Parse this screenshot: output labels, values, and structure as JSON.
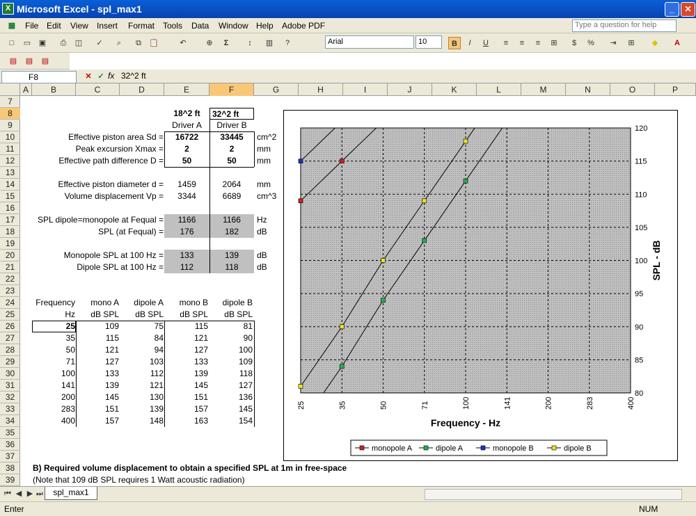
{
  "window": {
    "title": "Microsoft Excel - spl_max1"
  },
  "menu": [
    "File",
    "Edit",
    "View",
    "Insert",
    "Format",
    "Tools",
    "Data",
    "Window",
    "Help",
    "Adobe PDF"
  ],
  "ask_placeholder": "Type a question for help",
  "toolbar": {
    "font": "Arial",
    "size": "10"
  },
  "formula_bar": {
    "cell_ref": "F8",
    "formula": "32^2 ft"
  },
  "columns": [
    "A",
    "B",
    "C",
    "D",
    "E",
    "F",
    "G",
    "H",
    "I",
    "J",
    "K",
    "L",
    "M",
    "N",
    "O",
    "P"
  ],
  "rows": [
    "7",
    "8",
    "9",
    "10",
    "11",
    "12",
    "13",
    "14",
    "15",
    "16",
    "17",
    "18",
    "19",
    "20",
    "21",
    "22",
    "23",
    "24",
    "25",
    "26",
    "27",
    "28",
    "29",
    "30",
    "31",
    "32",
    "33",
    "34",
    "35",
    "36",
    "37",
    "38",
    "39"
  ],
  "sheet": {
    "size_a": "18^2 ft",
    "size_b": "32^2 ft",
    "driver_a": "Driver A",
    "driver_b": "Driver B",
    "params": [
      {
        "label": "Effective piston area Sd =",
        "a": "16722",
        "b": "33445",
        "unit": "cm^2"
      },
      {
        "label": "Peak excursion Xmax =",
        "a": "2",
        "b": "2",
        "unit": "mm"
      },
      {
        "label": "Effective path difference D =",
        "a": "50",
        "b": "50",
        "unit": "mm"
      },
      {
        "label": "Effective piston diameter d =",
        "a": "1459",
        "b": "2064",
        "unit": "mm"
      },
      {
        "label": "Volume displacement Vp =",
        "a": "3344",
        "b": "6689",
        "unit": "cm^3"
      },
      {
        "label": "SPL dipole=monopole at Fequal =",
        "a": "1166",
        "b": "1166",
        "unit": "Hz"
      },
      {
        "label": "SPL (at Fequal) =",
        "a": "176",
        "b": "182",
        "unit": "dB"
      },
      {
        "label": "Monopole SPL at 100 Hz =",
        "a": "133",
        "b": "139",
        "unit": "dB"
      },
      {
        "label": "Dipole SPL at 100 Hz =",
        "a": "112",
        "b": "118",
        "unit": "dB"
      }
    ],
    "table_headers": {
      "row1": [
        "Frequency",
        "mono A",
        "dipole A",
        "mono B",
        "dipole B"
      ],
      "row2": [
        "Hz",
        "dB SPL",
        "dB SPL",
        "dB SPL",
        "dB SPL"
      ]
    },
    "table_rows": [
      [
        "25",
        "109",
        "75",
        "115",
        "81"
      ],
      [
        "35",
        "115",
        "84",
        "121",
        "90"
      ],
      [
        "50",
        "121",
        "94",
        "127",
        "100"
      ],
      [
        "71",
        "127",
        "103",
        "133",
        "109"
      ],
      [
        "100",
        "133",
        "112",
        "139",
        "118"
      ],
      [
        "141",
        "139",
        "121",
        "145",
        "127"
      ],
      [
        "200",
        "145",
        "130",
        "151",
        "136"
      ],
      [
        "283",
        "151",
        "139",
        "157",
        "145"
      ],
      [
        "400",
        "157",
        "148",
        "163",
        "154"
      ]
    ],
    "note_b": "B)  Required volume displacement to obtain a specified SPL at 1m in free-space",
    "note_b2": "(Note that 109 dB SPL requires 1 Watt acoustic radiation)"
  },
  "chart_data": {
    "type": "line",
    "xlabel": "Frequency - Hz",
    "ylabel": "SPL - dB",
    "categories": [
      "25",
      "35",
      "50",
      "71",
      "100",
      "141",
      "200",
      "283",
      "400"
    ],
    "ylim": [
      80,
      120
    ],
    "yticks": [
      "80",
      "85",
      "90",
      "95",
      "100",
      "105",
      "110",
      "115",
      "120"
    ],
    "series": [
      {
        "name": "monopole A",
        "color": "#d42020",
        "values": [
          109,
          115,
          121,
          127,
          133,
          139,
          145,
          151,
          157
        ]
      },
      {
        "name": "dipole A",
        "color": "#22b24c",
        "values": [
          75,
          84,
          94,
          103,
          112,
          121,
          130,
          139,
          148
        ]
      },
      {
        "name": "monopole B",
        "color": "#2030c0",
        "values": [
          115,
          121,
          127,
          133,
          139,
          145,
          151,
          157,
          163
        ]
      },
      {
        "name": "dipole B",
        "color": "#f0e020",
        "values": [
          81,
          90,
          100,
          109,
          118,
          127,
          136,
          145,
          154
        ]
      }
    ],
    "grid": true,
    "legend_position": "bottom"
  },
  "sheet_tab": "spl_max1",
  "status": {
    "left": "Enter",
    "right": "NUM"
  }
}
